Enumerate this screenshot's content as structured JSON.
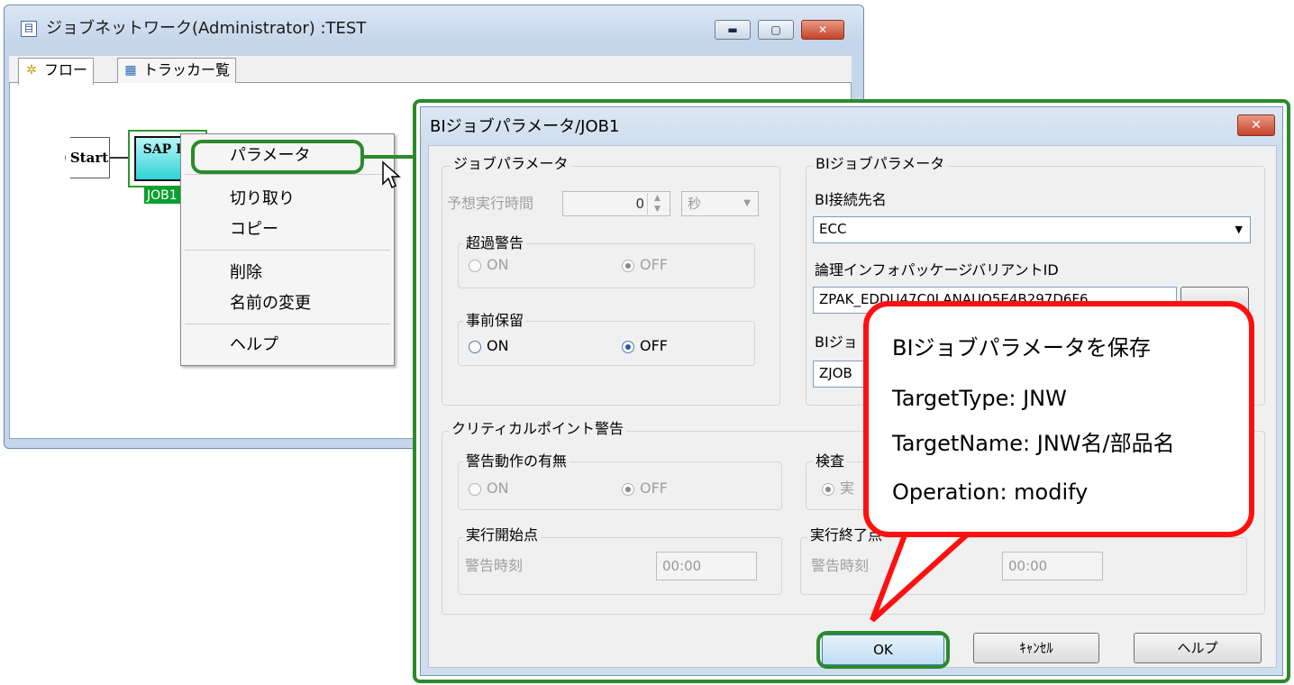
{
  "bg_window": {
    "title": "ジョブネットワーク(Administrator) :TEST",
    "tabs": [
      {
        "label": "フロー"
      },
      {
        "label": "トラッカー覧"
      }
    ],
    "start_label": "Start",
    "job_icon_text": "SAP BI",
    "job_label": "JOB1"
  },
  "context_menu": {
    "items": [
      {
        "label": "パラメータ"
      },
      {
        "label": "切り取り"
      },
      {
        "label": "コピー"
      },
      {
        "label": "削除"
      },
      {
        "label": "名前の変更"
      },
      {
        "label": "ヘルプ"
      }
    ]
  },
  "dialog": {
    "title": "BIジョブパラメータ/JOB1",
    "job_params": {
      "group_label": "ジョブパラメータ",
      "expected_time_label": "予想実行時間",
      "expected_time_value": "0",
      "unit_value": "秒",
      "overtime_warning": {
        "label": "超過警告",
        "on": "ON",
        "off": "OFF"
      },
      "pre_hold": {
        "label": "事前保留",
        "on": "ON",
        "off": "OFF"
      }
    },
    "bi_params": {
      "group_label": "BIジョブパラメータ",
      "connection_label": "BI接続先名",
      "connection_value": "ECC",
      "ip_variant_label": "論理インフォパッケージバリアントID",
      "ip_variant_value": "ZPAK_EDDU47C0LANAUQ5E4B297D6F6",
      "job_label_partial": "BIジョ",
      "job_value_partial": "ZJOB"
    },
    "critical": {
      "group_label": "クリティカルポイント警告",
      "action_label": "警告動作の有無",
      "on": "ON",
      "off": "OFF",
      "check_label_partial": "検査",
      "check_radio_partial": "実",
      "start_label": "実行開始点",
      "start_time_label": "警告時刻",
      "start_time_value": "00:00",
      "end_label": "実行終了点",
      "end_time_label": "警告時刻",
      "end_time_value": "00:00"
    },
    "buttons": {
      "ok": "OK",
      "cancel": "ｷｬﾝｾﾙ",
      "help": "ヘルプ"
    }
  },
  "callout": {
    "lines": [
      "BIジョブパラメータを保存",
      "TargetType: JNW",
      "TargetName: JNW名/部品名",
      "Operation: modify"
    ]
  },
  "colors": {
    "highlight_green": "#2b8a2b",
    "callout_red": "#ff1010"
  }
}
